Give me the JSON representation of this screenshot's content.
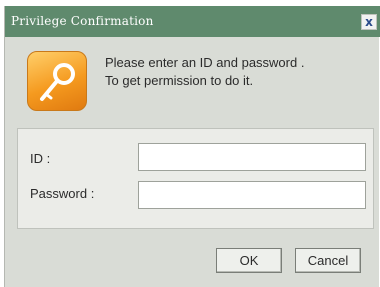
{
  "window": {
    "title": "Privilege Confirmation",
    "close_label": "x"
  },
  "message": {
    "line1": "Please enter an ID and password .",
    "line2": "To get permission to do it."
  },
  "form": {
    "id_label": "ID :",
    "id_value": "",
    "password_label": "Password :",
    "password_value": ""
  },
  "buttons": {
    "ok_label": "OK",
    "cancel_label": "Cancel"
  },
  "icons": {
    "dialog_icon": "key-icon"
  },
  "colors": {
    "titlebar": "#5f8a6d",
    "dialog_bg": "#d9dcd6",
    "icon_orange": "#f59a1f"
  }
}
